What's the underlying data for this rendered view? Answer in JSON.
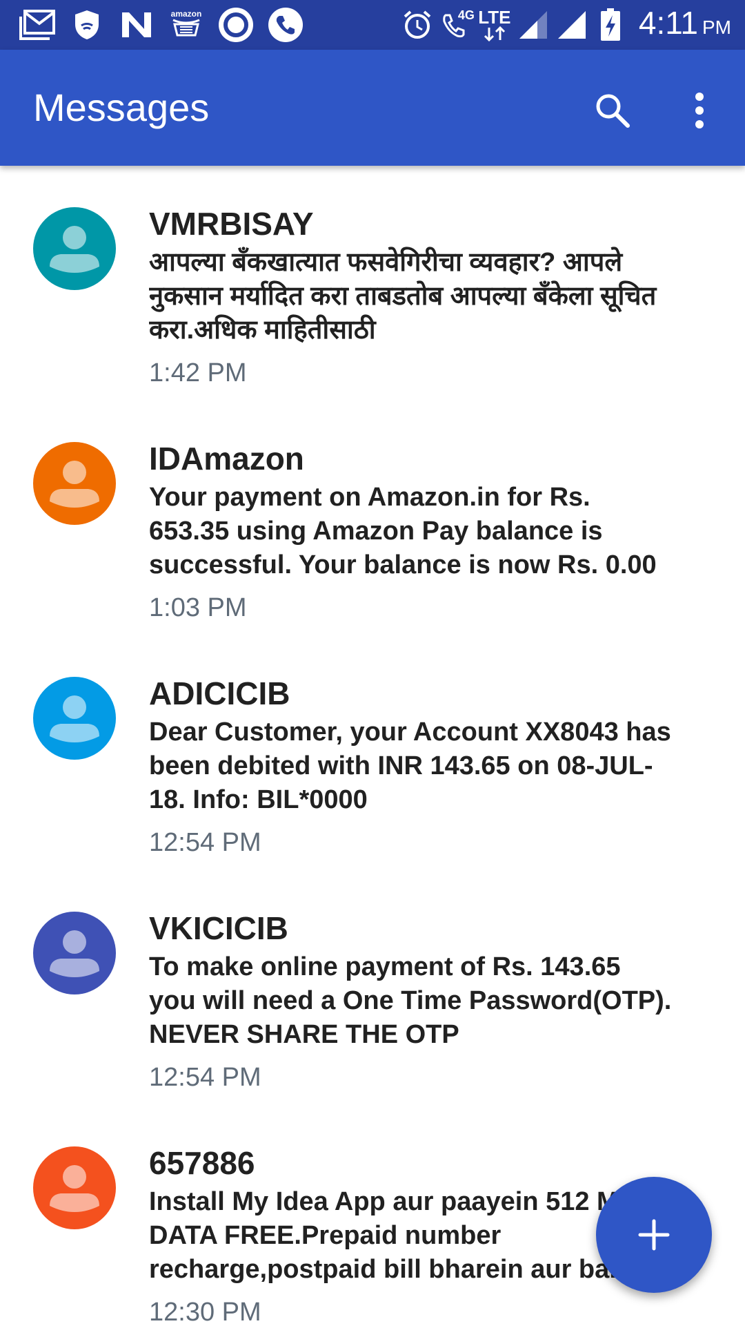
{
  "status_bar": {
    "left_icons": [
      "gmail-icon",
      "shield-icon",
      "n-icon",
      "amazon-icon",
      "circle-app-icon",
      "phone-app-icon"
    ],
    "amazon_label": "amazon",
    "right_icons": [
      "alarm-icon",
      "volte-call-icon",
      "lte-icon",
      "signal-icon",
      "signal-icon",
      "battery-charging-icon"
    ],
    "network_label": "4G",
    "lte_label": "LTE",
    "time": "4:11",
    "ampm": "PM",
    "background_color": "#263f9e"
  },
  "app_bar": {
    "title": "Messages",
    "actions": [
      "search-icon",
      "more-vert-icon"
    ],
    "background_color": "#2f56c6"
  },
  "conversations": [
    {
      "sender": "VMRBISAY",
      "snippet": "आपल्या बँकखात्यात फसवेगिरीचा व्यवहार? आपले नुकसान मर्यादित करा ताबडतोब आपल्या बँकेला सूचित करा.अधिक माहितीसाठी",
      "time": "1:42 PM",
      "avatar_color": "#0097a7"
    },
    {
      "sender": "IDAmazon",
      "snippet": "Your payment on Amazon.in for Rs. 653.35 using Amazon Pay balance is successful. Your balance is now Rs. 0.00",
      "time": "1:03 PM",
      "avatar_color": "#ef6c00"
    },
    {
      "sender": "ADICICIB",
      "snippet": "Dear Customer, your Account XX8043 has been debited with INR 143.65 on 08-JUL-18. Info: BIL*0000",
      "time": "12:54 PM",
      "avatar_color": "#039be5"
    },
    {
      "sender": "VKICICIB",
      "snippet": "To make online payment of Rs. 143.65 you will need a One Time Password(OTP). NEVER SHARE THE OTP",
      "time": "12:54 PM",
      "avatar_color": "#3f51b5"
    },
    {
      "sender": "657886",
      "snippet": "Install My Idea App aur paayein 512 MB DATA FREE.Prepaid number recharge,postpaid bill bharein aur bahut",
      "time": "12:30 PM",
      "avatar_color": "#f4511e"
    }
  ],
  "fab": {
    "icon": "plus-icon",
    "background_color": "#2f56c6"
  }
}
